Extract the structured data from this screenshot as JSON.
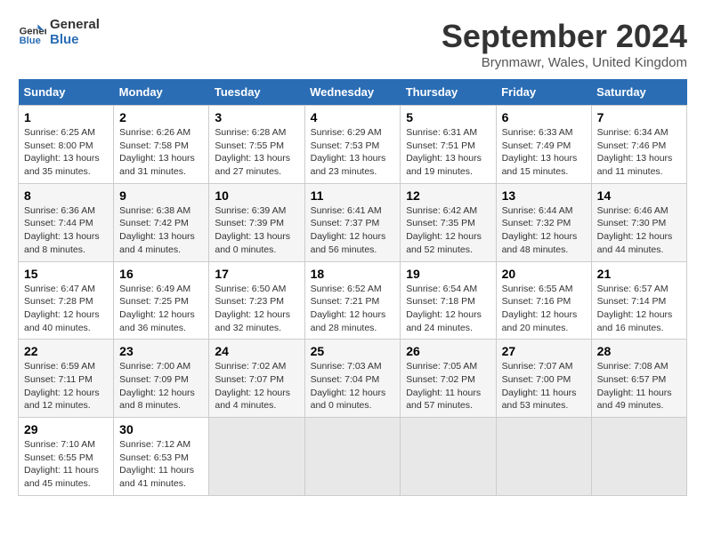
{
  "logo": {
    "line1": "General",
    "line2": "Blue"
  },
  "title": "September 2024",
  "location": "Brynmawr, Wales, United Kingdom",
  "headers": [
    "Sunday",
    "Monday",
    "Tuesday",
    "Wednesday",
    "Thursday",
    "Friday",
    "Saturday"
  ],
  "weeks": [
    [
      {
        "day": "1",
        "info": "Sunrise: 6:25 AM\nSunset: 8:00 PM\nDaylight: 13 hours\nand 35 minutes."
      },
      {
        "day": "2",
        "info": "Sunrise: 6:26 AM\nSunset: 7:58 PM\nDaylight: 13 hours\nand 31 minutes."
      },
      {
        "day": "3",
        "info": "Sunrise: 6:28 AM\nSunset: 7:55 PM\nDaylight: 13 hours\nand 27 minutes."
      },
      {
        "day": "4",
        "info": "Sunrise: 6:29 AM\nSunset: 7:53 PM\nDaylight: 13 hours\nand 23 minutes."
      },
      {
        "day": "5",
        "info": "Sunrise: 6:31 AM\nSunset: 7:51 PM\nDaylight: 13 hours\nand 19 minutes."
      },
      {
        "day": "6",
        "info": "Sunrise: 6:33 AM\nSunset: 7:49 PM\nDaylight: 13 hours\nand 15 minutes."
      },
      {
        "day": "7",
        "info": "Sunrise: 6:34 AM\nSunset: 7:46 PM\nDaylight: 13 hours\nand 11 minutes."
      }
    ],
    [
      {
        "day": "8",
        "info": "Sunrise: 6:36 AM\nSunset: 7:44 PM\nDaylight: 13 hours\nand 8 minutes."
      },
      {
        "day": "9",
        "info": "Sunrise: 6:38 AM\nSunset: 7:42 PM\nDaylight: 13 hours\nand 4 minutes."
      },
      {
        "day": "10",
        "info": "Sunrise: 6:39 AM\nSunset: 7:39 PM\nDaylight: 13 hours\nand 0 minutes."
      },
      {
        "day": "11",
        "info": "Sunrise: 6:41 AM\nSunset: 7:37 PM\nDaylight: 12 hours\nand 56 minutes."
      },
      {
        "day": "12",
        "info": "Sunrise: 6:42 AM\nSunset: 7:35 PM\nDaylight: 12 hours\nand 52 minutes."
      },
      {
        "day": "13",
        "info": "Sunrise: 6:44 AM\nSunset: 7:32 PM\nDaylight: 12 hours\nand 48 minutes."
      },
      {
        "day": "14",
        "info": "Sunrise: 6:46 AM\nSunset: 7:30 PM\nDaylight: 12 hours\nand 44 minutes."
      }
    ],
    [
      {
        "day": "15",
        "info": "Sunrise: 6:47 AM\nSunset: 7:28 PM\nDaylight: 12 hours\nand 40 minutes."
      },
      {
        "day": "16",
        "info": "Sunrise: 6:49 AM\nSunset: 7:25 PM\nDaylight: 12 hours\nand 36 minutes."
      },
      {
        "day": "17",
        "info": "Sunrise: 6:50 AM\nSunset: 7:23 PM\nDaylight: 12 hours\nand 32 minutes."
      },
      {
        "day": "18",
        "info": "Sunrise: 6:52 AM\nSunset: 7:21 PM\nDaylight: 12 hours\nand 28 minutes."
      },
      {
        "day": "19",
        "info": "Sunrise: 6:54 AM\nSunset: 7:18 PM\nDaylight: 12 hours\nand 24 minutes."
      },
      {
        "day": "20",
        "info": "Sunrise: 6:55 AM\nSunset: 7:16 PM\nDaylight: 12 hours\nand 20 minutes."
      },
      {
        "day": "21",
        "info": "Sunrise: 6:57 AM\nSunset: 7:14 PM\nDaylight: 12 hours\nand 16 minutes."
      }
    ],
    [
      {
        "day": "22",
        "info": "Sunrise: 6:59 AM\nSunset: 7:11 PM\nDaylight: 12 hours\nand 12 minutes."
      },
      {
        "day": "23",
        "info": "Sunrise: 7:00 AM\nSunset: 7:09 PM\nDaylight: 12 hours\nand 8 minutes."
      },
      {
        "day": "24",
        "info": "Sunrise: 7:02 AM\nSunset: 7:07 PM\nDaylight: 12 hours\nand 4 minutes."
      },
      {
        "day": "25",
        "info": "Sunrise: 7:03 AM\nSunset: 7:04 PM\nDaylight: 12 hours\nand 0 minutes."
      },
      {
        "day": "26",
        "info": "Sunrise: 7:05 AM\nSunset: 7:02 PM\nDaylight: 11 hours\nand 57 minutes."
      },
      {
        "day": "27",
        "info": "Sunrise: 7:07 AM\nSunset: 7:00 PM\nDaylight: 11 hours\nand 53 minutes."
      },
      {
        "day": "28",
        "info": "Sunrise: 7:08 AM\nSunset: 6:57 PM\nDaylight: 11 hours\nand 49 minutes."
      }
    ],
    [
      {
        "day": "29",
        "info": "Sunrise: 7:10 AM\nSunset: 6:55 PM\nDaylight: 11 hours\nand 45 minutes."
      },
      {
        "day": "30",
        "info": "Sunrise: 7:12 AM\nSunset: 6:53 PM\nDaylight: 11 hours\nand 41 minutes."
      },
      {
        "day": "",
        "info": ""
      },
      {
        "day": "",
        "info": ""
      },
      {
        "day": "",
        "info": ""
      },
      {
        "day": "",
        "info": ""
      },
      {
        "day": "",
        "info": ""
      }
    ]
  ]
}
